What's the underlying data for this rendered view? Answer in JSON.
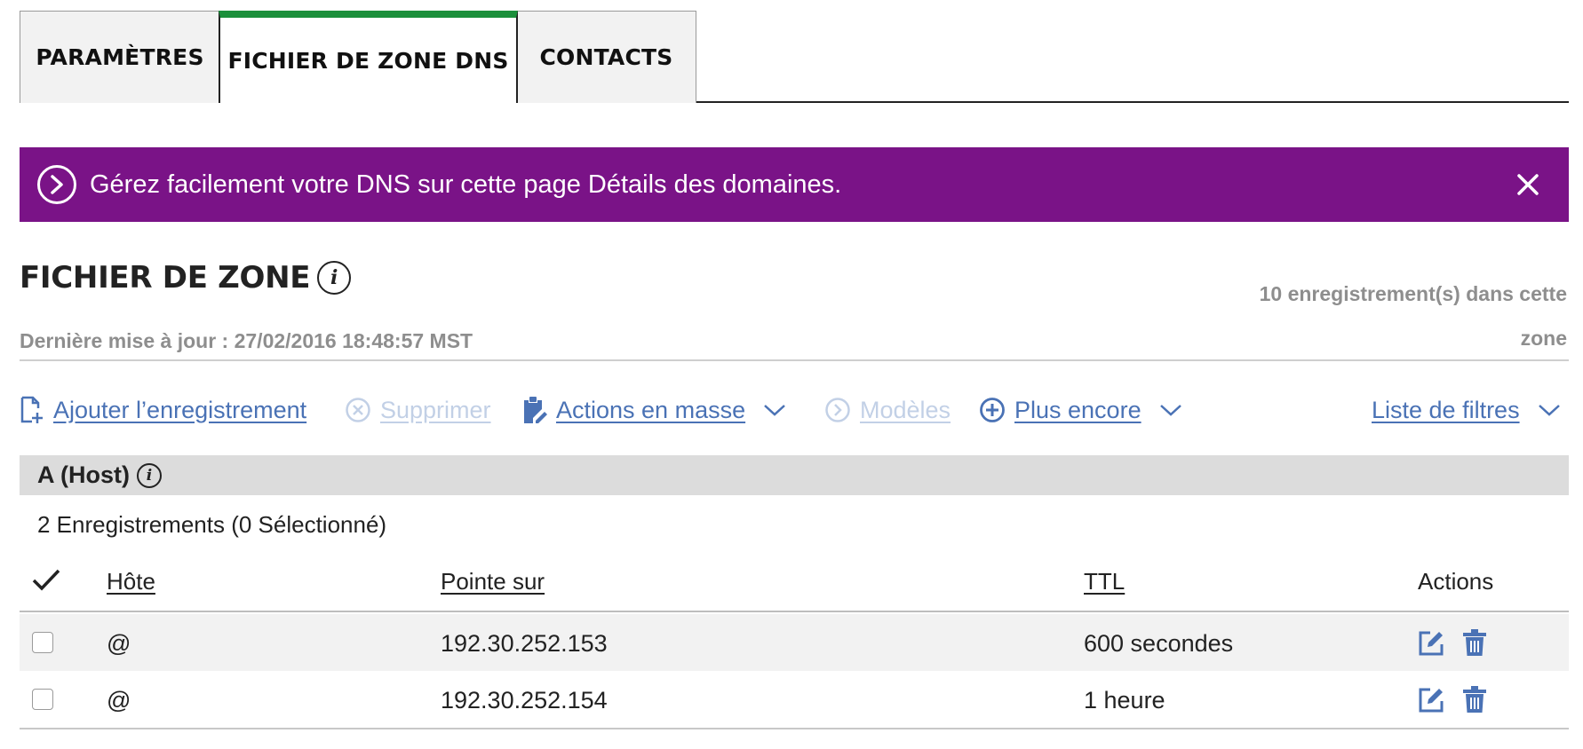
{
  "tabs": [
    {
      "label": "PARAMÈTRES",
      "active": false
    },
    {
      "label": "FICHIER DE ZONE DNS",
      "active": true
    },
    {
      "label": "CONTACTS",
      "active": false
    }
  ],
  "banner": {
    "message": "Gérez facilement votre DNS sur cette page Détails des domaines.",
    "background": "#7a1387",
    "icon": "chevron-right-circle-icon",
    "close_icon": "close-icon"
  },
  "zone": {
    "title": "FICHIER DE ZONE",
    "info_glyph": "i",
    "last_update": "Dernière mise à jour : 27/02/2016 18:48:57 MST",
    "records_count_line1": "10 enregistrement(s) dans cette",
    "records_count_line2": "zone"
  },
  "toolbar": {
    "add": {
      "label": "Ajouter l’enregistrement",
      "icon": "add-document-icon",
      "enabled": true
    },
    "delete": {
      "label": "Supprimer",
      "icon": "x-circle-icon",
      "enabled": false
    },
    "bulk": {
      "label": "Actions en masse",
      "icon": "clipboard-edit-icon",
      "enabled": true
    },
    "templates": {
      "label": "Modèles",
      "icon": "chevron-right-circle-icon",
      "enabled": false
    },
    "more": {
      "label": "Plus encore",
      "icon": "plus-circle-icon",
      "enabled": true
    },
    "filters": {
      "label": "Liste de filtres",
      "enabled": true
    },
    "link_color": "#4a72b5",
    "disabled_color": "#c2d0e6"
  },
  "section": {
    "title": "A (Host)",
    "info_glyph": "i",
    "selection": "2 Enregistrements (0 Sélectionné)"
  },
  "table": {
    "headers": {
      "host": "Hôte",
      "points_to": "Pointe sur",
      "ttl": "TTL",
      "actions": "Actions"
    },
    "rows": [
      {
        "host": "@",
        "points_to": "192.30.252.153",
        "ttl": "600 secondes",
        "checked": false
      },
      {
        "host": "@",
        "points_to": "192.30.252.154",
        "ttl": "1 heure",
        "checked": false
      }
    ]
  },
  "accent_colors": {
    "active_tab": "#1b8f3b",
    "icon_blue": "#4a72b5"
  }
}
